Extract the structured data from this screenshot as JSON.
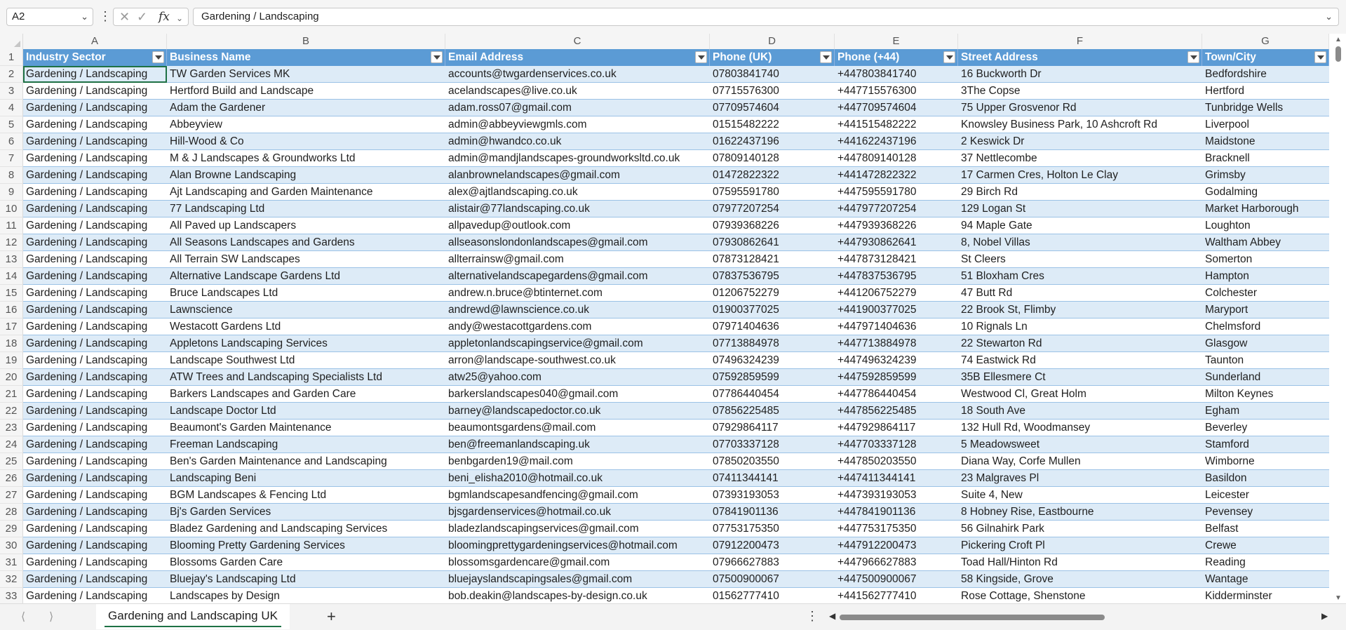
{
  "formula_bar": {
    "name_box": "A2",
    "fx_label": "fx",
    "formula": "Gardening / Landscaping"
  },
  "columns": [
    "A",
    "B",
    "C",
    "D",
    "E",
    "F",
    "G"
  ],
  "headers": [
    "Industry Sector",
    "Business Name",
    "Email Address",
    "Phone (UK)",
    "Phone (+44)",
    "Street Address",
    "Town/City"
  ],
  "rows": [
    [
      "Gardening / Landscaping",
      "TW Garden Services MK",
      "accounts@twgardenservices.co.uk",
      "07803841740",
      "+447803841740",
      "16 Buckworth Dr",
      "Bedfordshire"
    ],
    [
      "Gardening / Landscaping",
      "Hertford Build and Landscape",
      "acelandscapes@live.co.uk",
      "07715576300",
      "+447715576300",
      "3The Copse",
      "Hertford"
    ],
    [
      "Gardening / Landscaping",
      "Adam the Gardener",
      "adam.ross07@gmail.com",
      "07709574604",
      "+447709574604",
      "75 Upper Grosvenor Rd",
      "Tunbridge Wells"
    ],
    [
      "Gardening / Landscaping",
      "Abbeyview",
      "admin@abbeyviewgmls.com",
      "01515482222",
      "+441515482222",
      "Knowsley Business Park, 10 Ashcroft Rd",
      "Liverpool"
    ],
    [
      "Gardening / Landscaping",
      "Hill-Wood & Co",
      "admin@hwandco.co.uk",
      "01622437196",
      "+441622437196",
      "2 Keswick Dr",
      "Maidstone"
    ],
    [
      "Gardening / Landscaping",
      "M & J Landscapes & Groundworks Ltd",
      "admin@mandjlandscapes-groundworksltd.co.uk",
      "07809140128",
      "+447809140128",
      "37 Nettlecombe",
      "Bracknell"
    ],
    [
      "Gardening / Landscaping",
      "Alan Browne Landscaping",
      "alanbrownelandscapes@gmail.com",
      "01472822322",
      "+441472822322",
      "17 Carmen Cres, Holton Le Clay",
      "Grimsby"
    ],
    [
      "Gardening / Landscaping",
      "Ajt Landscaping and Garden Maintenance",
      "alex@ajtlandscaping.co.uk",
      "07595591780",
      "+447595591780",
      "29 Birch Rd",
      "Godalming"
    ],
    [
      "Gardening / Landscaping",
      "77 Landscaping Ltd",
      "alistair@77landscaping.co.uk",
      "07977207254",
      "+447977207254",
      "129 Logan St",
      "Market Harborough"
    ],
    [
      "Gardening / Landscaping",
      "All Paved up Landscapers",
      "allpavedup@outlook.com",
      "07939368226",
      "+447939368226",
      "94 Maple Gate",
      "Loughton"
    ],
    [
      "Gardening / Landscaping",
      "All Seasons Landscapes and Gardens",
      "allseasonslondonlandscapes@gmail.com",
      "07930862641",
      "+447930862641",
      "8, Nobel Villas",
      "Waltham Abbey"
    ],
    [
      "Gardening / Landscaping",
      "All Terrain SW Landscapes",
      "allterrainsw@gmail.com",
      "07873128421",
      "+447873128421",
      "St Cleers",
      "Somerton"
    ],
    [
      "Gardening / Landscaping",
      "Alternative Landscape Gardens Ltd",
      "alternativelandscapegardens@gmail.com",
      "07837536795",
      "+447837536795",
      "51 Bloxham Cres",
      "Hampton"
    ],
    [
      "Gardening / Landscaping",
      "Bruce Landscapes Ltd",
      "andrew.n.bruce@btinternet.com",
      "01206752279",
      "+441206752279",
      "47 Butt Rd",
      "Colchester"
    ],
    [
      "Gardening / Landscaping",
      "Lawnscience",
      "andrewd@lawnscience.co.uk",
      "01900377025",
      "+441900377025",
      "22 Brook St, Flimby",
      "Maryport"
    ],
    [
      "Gardening / Landscaping",
      "Westacott Gardens Ltd",
      "andy@westacottgardens.com",
      "07971404636",
      "+447971404636",
      "10 Rignals Ln",
      "Chelmsford"
    ],
    [
      "Gardening / Landscaping",
      "Appletons Landscaping Services",
      "appletonlandscapingservice@gmail.com",
      "07713884978",
      "+447713884978",
      "22 Stewarton Rd",
      "Glasgow"
    ],
    [
      "Gardening / Landscaping",
      "Landscape Southwest Ltd",
      "arron@landscape-southwest.co.uk",
      "07496324239",
      "+447496324239",
      "74 Eastwick Rd",
      "Taunton"
    ],
    [
      "Gardening / Landscaping",
      "ATW Trees and Landscaping Specialists Ltd",
      "atw25@yahoo.com",
      "07592859599",
      "+447592859599",
      "35B Ellesmere Ct",
      "Sunderland"
    ],
    [
      "Gardening / Landscaping",
      "Barkers Landscapes and Garden Care",
      "barkerslandscapes040@gmail.com",
      "07786440454",
      "+447786440454",
      "Westwood Cl, Great Holm",
      "Milton Keynes"
    ],
    [
      "Gardening / Landscaping",
      "Landscape Doctor Ltd",
      "barney@landscapedoctor.co.uk",
      "07856225485",
      "+447856225485",
      "18 South Ave",
      "Egham"
    ],
    [
      "Gardening / Landscaping",
      "Beaumont's Garden Maintenance",
      "beaumontsgardens@mail.com",
      "07929864117",
      "+447929864117",
      "132 Hull Rd, Woodmansey",
      "Beverley"
    ],
    [
      "Gardening / Landscaping",
      "Freeman Landscaping",
      "ben@freemanlandscaping.uk",
      "07703337128",
      "+447703337128",
      "5 Meadowsweet",
      "Stamford"
    ],
    [
      "Gardening / Landscaping",
      "Ben's Garden Maintenance and Landscaping",
      "benbgarden19@mail.com",
      "07850203550",
      "+447850203550",
      "Diana Way, Corfe Mullen",
      "Wimborne"
    ],
    [
      "Gardening / Landscaping",
      "Landscaping Beni",
      "beni_elisha2010@hotmail.co.uk",
      "07411344141",
      "+447411344141",
      "23 Malgraves Pl",
      "Basildon"
    ],
    [
      "Gardening / Landscaping",
      "BGM Landscapes & Fencing Ltd",
      "bgmlandscapesandfencing@gmail.com",
      "07393193053",
      "+447393193053",
      "Suite 4, New",
      "Leicester"
    ],
    [
      "Gardening / Landscaping",
      "Bj's Garden Services",
      "bjsgardenservices@hotmail.co.uk",
      "07841901136",
      "+447841901136",
      "8 Hobney Rise, Eastbourne",
      "Pevensey"
    ],
    [
      "Gardening / Landscaping",
      "Bladez Gardening and Landscaping Services",
      "bladezlandscapingservices@gmail.com",
      "07753175350",
      "+447753175350",
      "56 Gilnahirk Park",
      "Belfast"
    ],
    [
      "Gardening / Landscaping",
      "Blooming Pretty Gardening Services",
      "bloomingprettygardeningservices@hotmail.com",
      "07912200473",
      "+447912200473",
      "Pickering Croft Pl",
      "Crewe"
    ],
    [
      "Gardening / Landscaping",
      "Blossoms Garden Care",
      "blossomsgardencare@gmail.com",
      "07966627883",
      "+447966627883",
      "Toad Hall/Hinton Rd",
      "Reading"
    ],
    [
      "Gardening / Landscaping",
      "Bluejay's Landscaping Ltd",
      "bluejayslandscapingsales@gmail.com",
      "07500900067",
      "+447500900067",
      "58 Kingside, Grove",
      "Wantage"
    ],
    [
      "Gardening / Landscaping",
      "Landscapes by Design",
      "bob.deakin@landscapes-by-design.co.uk",
      "01562777410",
      "+441562777410",
      "Rose Cottage, Shenstone",
      "Kidderminster"
    ]
  ],
  "sheet_tab": "Gardening and Landscaping UK",
  "add_sheet": "+",
  "colors": {
    "header_fill": "#5b9bd5",
    "band_fill": "#ddebf7",
    "selection": "#1e7145"
  },
  "icons": [
    "chevron-down-icon",
    "more-icon",
    "cancel-icon",
    "enter-icon",
    "function-icon",
    "scroll-left-icon",
    "scroll-right-icon",
    "add-sheet-icon"
  ]
}
